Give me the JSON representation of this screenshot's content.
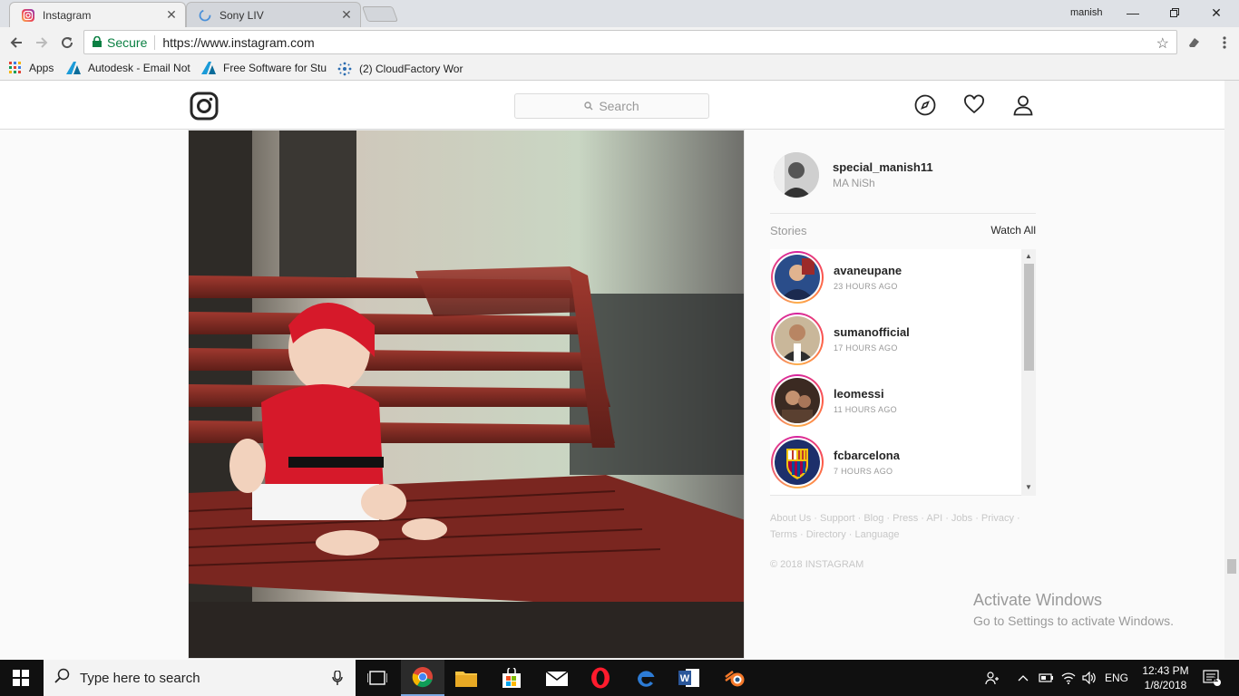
{
  "browser": {
    "tabs": [
      {
        "title": "Instagram",
        "active": true
      },
      {
        "title": "Sony LIV",
        "active": false
      }
    ],
    "profile_name": "manish",
    "secure_label": "Secure",
    "url": "https://www.instagram.com",
    "bookmarks": [
      {
        "label": "Apps",
        "icon": "apps-grid-icon"
      },
      {
        "label": "Autodesk - Email Not",
        "icon": "autodesk-icon"
      },
      {
        "label": "Free Software for Stu",
        "icon": "autodesk-icon"
      },
      {
        "label": "(2) CloudFactory Wor",
        "icon": "cloudfactory-icon"
      }
    ]
  },
  "instagram": {
    "search_placeholder": "Search",
    "profile": {
      "username": "special_manish11",
      "full_name": "MA NiSh"
    },
    "stories_label": "Stories",
    "watch_all": "Watch All",
    "stories": [
      {
        "user": "avaneupane",
        "time": "23 HOURS AGO"
      },
      {
        "user": "sumanofficial",
        "time": "17 HOURS AGO"
      },
      {
        "user": "leomessi",
        "time": "11 HOURS AGO"
      },
      {
        "user": "fcbarcelona",
        "time": "7 HOURS AGO"
      }
    ],
    "footer_line1": "About Us · Support · Blog · Press · API · Jobs · Privacy ·",
    "footer_line2": "Terms · Directory · Language",
    "copyright": "© 2018 INSTAGRAM"
  },
  "watermark": {
    "title": "Activate Windows",
    "subtitle": "Go to Settings to activate Windows."
  },
  "taskbar": {
    "search_placeholder": "Type here to search",
    "language": "ENG",
    "time": "12:43 PM",
    "date": "1/8/2018",
    "notification_count": "1"
  },
  "colors": {
    "secure_green": "#0b8043",
    "story_ring": "#d6249f",
    "taskbar": "#101010"
  }
}
